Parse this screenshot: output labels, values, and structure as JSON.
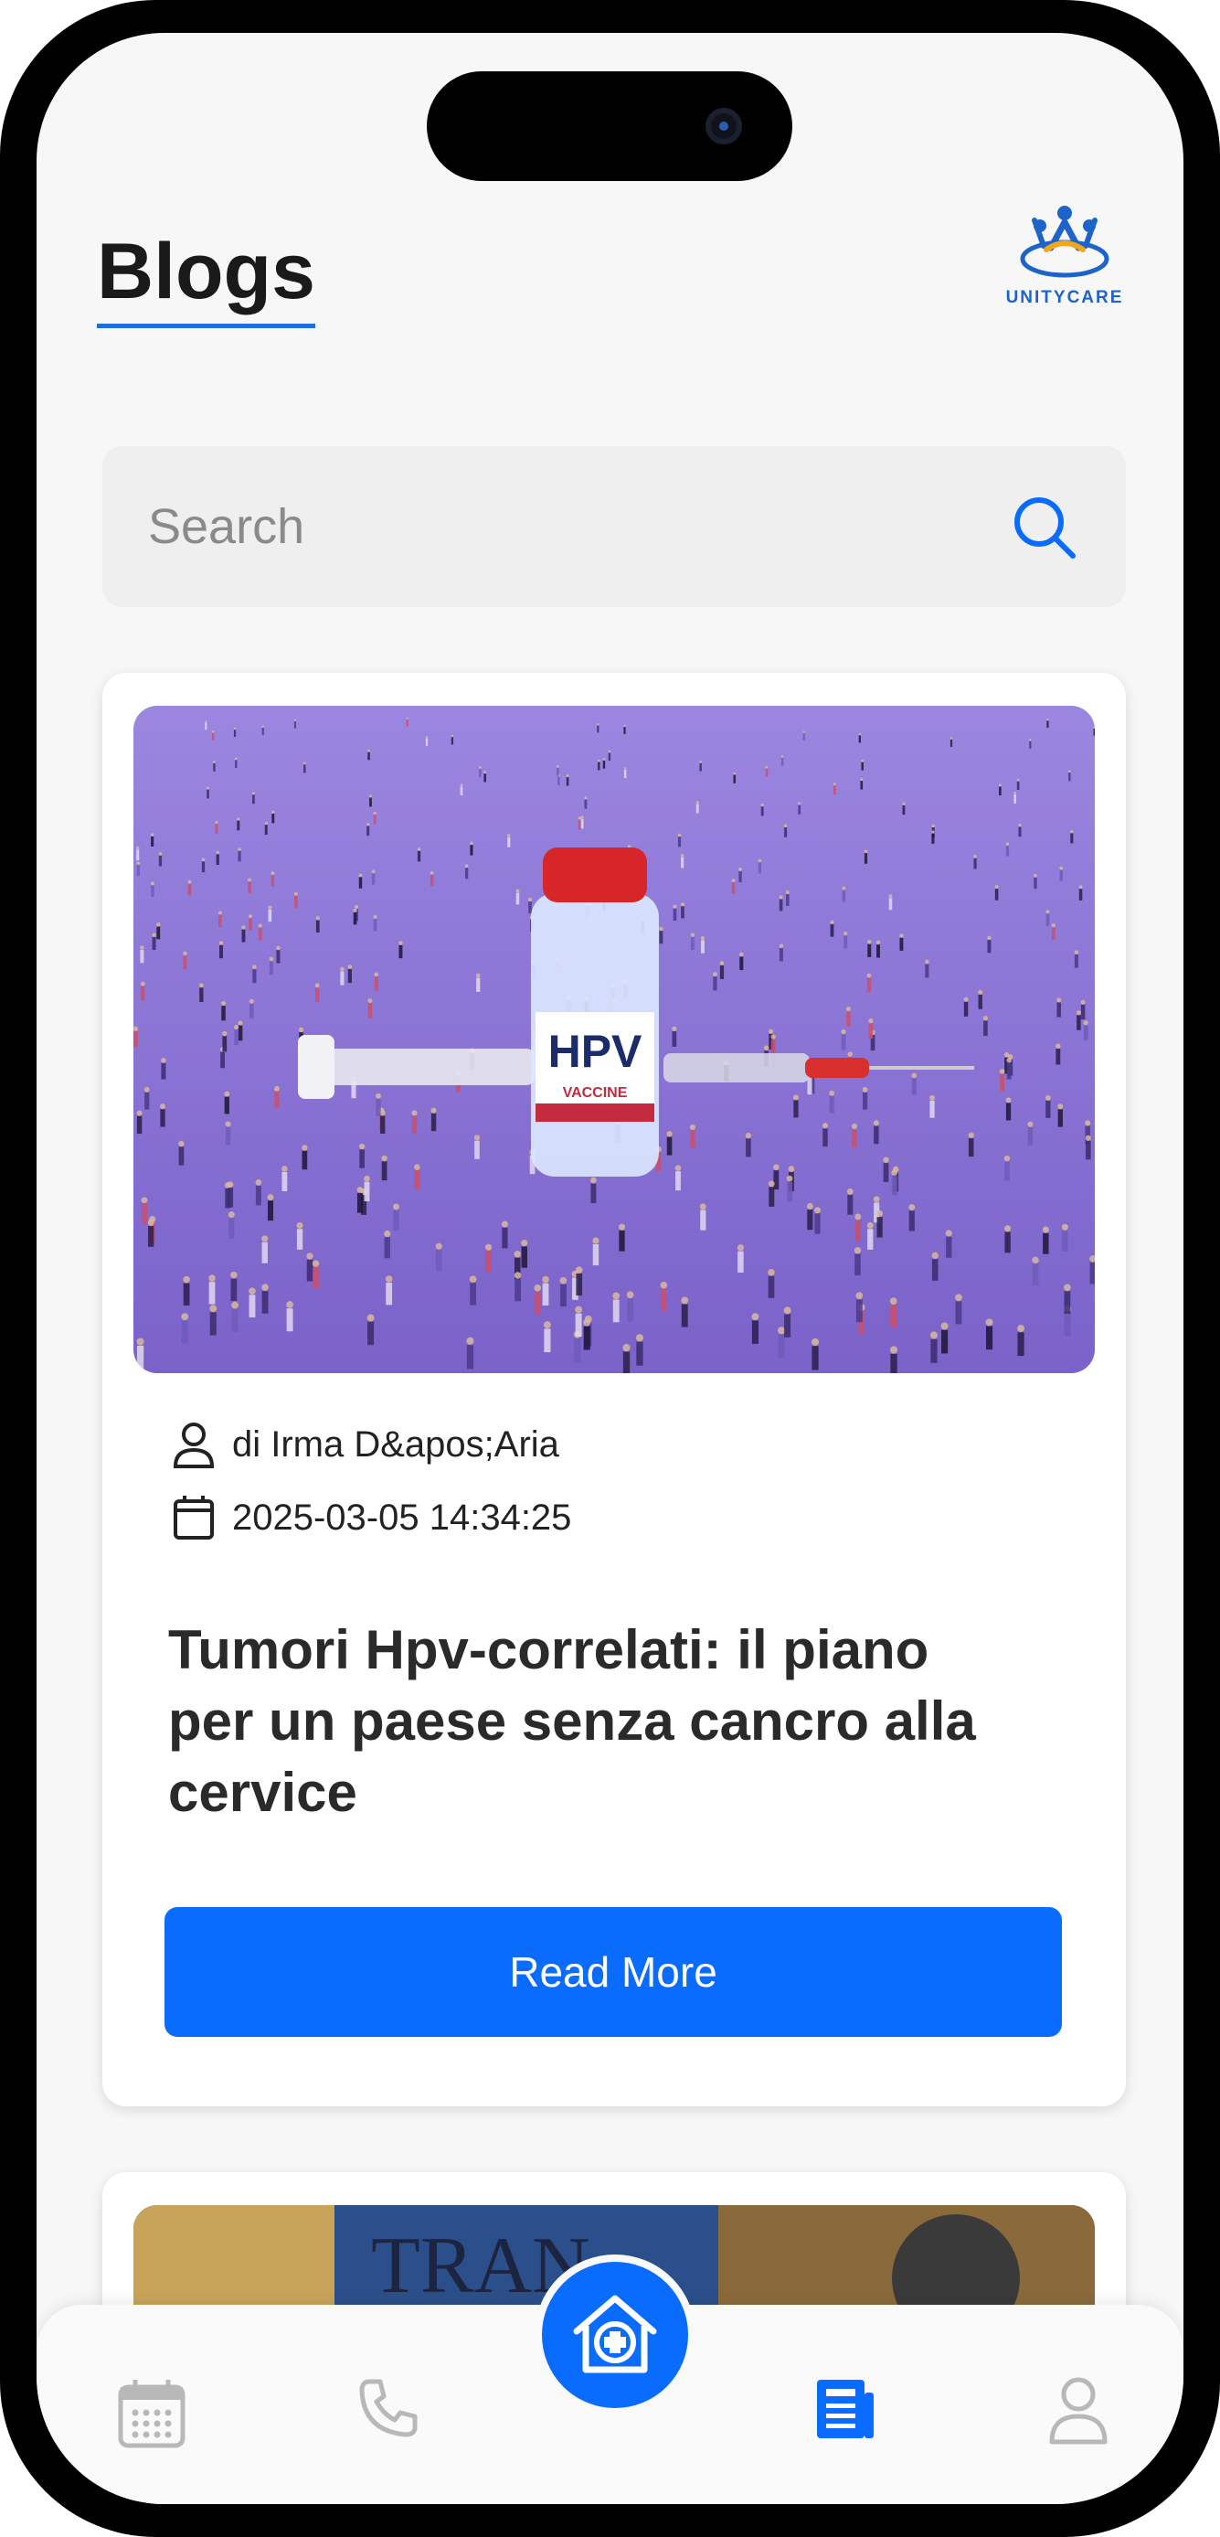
{
  "header": {
    "title": "Blogs"
  },
  "logo": {
    "name": "UNITYCARE",
    "tagline": "UNITYCARE"
  },
  "search": {
    "placeholder": "Search"
  },
  "posts": [
    {
      "author": "di Irma D&apos;Aria",
      "date": "2025-03-05 14:34:25",
      "title": "Tumori Hpv-correlati: il piano per un paese senza cancro alla cervice",
      "button_label": "Read More",
      "image": {
        "vial_label": "HPV",
        "vial_sub": "VACCINE"
      }
    },
    {
      "image": {
        "sign_text": "TRAN"
      }
    }
  ],
  "bottom_nav": {
    "items": [
      {
        "icon": "calendar-icon",
        "active": false
      },
      {
        "icon": "phone-icon",
        "active": false
      },
      {
        "icon": "hospital-home-icon",
        "active": true
      },
      {
        "icon": "news-icon",
        "active": true
      },
      {
        "icon": "user-icon",
        "active": false
      }
    ]
  },
  "colors": {
    "accent": "#0a6cff",
    "title_underline": "#1e6fd9",
    "background": "#f7f7f7"
  }
}
